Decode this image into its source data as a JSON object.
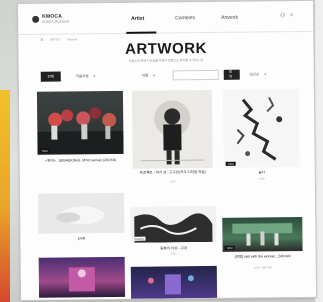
{
  "nav": {
    "logo_text": "KMOCA",
    "logo_sub": "KOREA MUSEUM",
    "items": [
      "Artist",
      "Contents",
      "Artwork"
    ],
    "active": "Artist"
  },
  "breadcrumb": [
    "홈",
    "ARTIST",
    "Artwork"
  ],
  "page": {
    "title": "ARTWORK",
    "subtitle": "작품소개 위해 전시품을 다양한 방법으로 찾아볼 수 있습니다"
  },
  "filters": [
    {
      "label": "전체",
      "style": "dark"
    },
    {
      "label": "작품유형",
      "style": "plain"
    },
    {
      "label": "작품",
      "style": "plain"
    },
    {
      "label": "",
      "style": "light"
    },
    {
      "label": "검색",
      "style": "dark"
    },
    {
      "label": "최신순",
      "style": "plain"
    }
  ],
  "cards": [
    {
      "caption": "<위대> : SEBAEK(feat. off tot sense) (2019-8)",
      "sub": "",
      "tag": "Video"
    },
    {
      "caption": "프로젝트 - 작가 상 : 고구만(작가 디지털 작업)",
      "sub": "2017",
      "tag": ""
    },
    {
      "caption": "숨다",
      "sub": "2019",
      "tag": "Video"
    },
    {
      "caption": "pmB",
      "sub": "",
      "tag": ""
    },
    {
      "caption": "동화의 이상 - 고대",
      "sub": "2020",
      "tag": "Drawing"
    },
    {
      "caption": "[관점] visit with the woman _SOHAN",
      "sub": "2016 · 현장 작업",
      "tag": "Video"
    },
    {
      "caption": "",
      "sub": "",
      "tag": ""
    },
    {
      "caption": "",
      "sub": "",
      "tag": ""
    }
  ],
  "colors": {
    "accent": "#111111",
    "stripe_top": "#f1c12a",
    "stripe_bottom": "#d6472f"
  },
  "icons": {
    "user": "user-icon",
    "search": "search-icon"
  }
}
